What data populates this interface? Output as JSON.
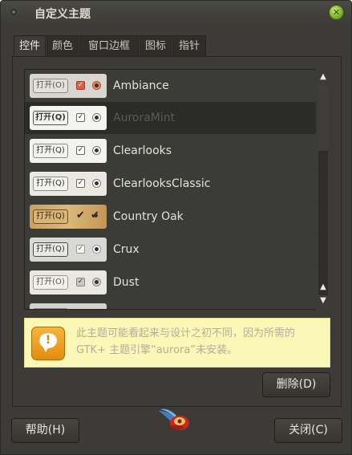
{
  "window": {
    "title": "自定义主题",
    "close_icon": "close-icon"
  },
  "tabs": [
    {
      "label": "控件",
      "active": true
    },
    {
      "label": "颜色",
      "active": false
    },
    {
      "label": "窗口边框",
      "active": false
    },
    {
      "label": "图标",
      "active": false
    },
    {
      "label": "指针",
      "active": false
    }
  ],
  "theme_list": {
    "preview_button_label": "打开(O)",
    "preview_button_label_alt": "打开(Q)",
    "items": [
      {
        "name": "Ambiance",
        "selected": false
      },
      {
        "name": "AuroraMint",
        "selected": true
      },
      {
        "name": "Clearlooks",
        "selected": false
      },
      {
        "name": "ClearlooksClassic",
        "selected": false
      },
      {
        "name": "Country Oak",
        "selected": false
      },
      {
        "name": "Crux",
        "selected": false
      },
      {
        "name": "Dust",
        "selected": false
      }
    ]
  },
  "warning": {
    "icon": "speech-bubble-exclamation-icon",
    "text": "此主题可能看起来与设计之初不同，因为所需的 GTK+ 主题引擎“aurora”未安装。"
  },
  "buttons": {
    "delete": "删除(D)",
    "help": "帮助(H)",
    "close": "关闭(C)"
  },
  "colors": {
    "window_bg": "#3c3b37",
    "selected_row": "#2b2b29",
    "warning_bg": "#fbf7b6",
    "warning_icon": "#e28b0c",
    "close_button": "#8fc33a"
  }
}
